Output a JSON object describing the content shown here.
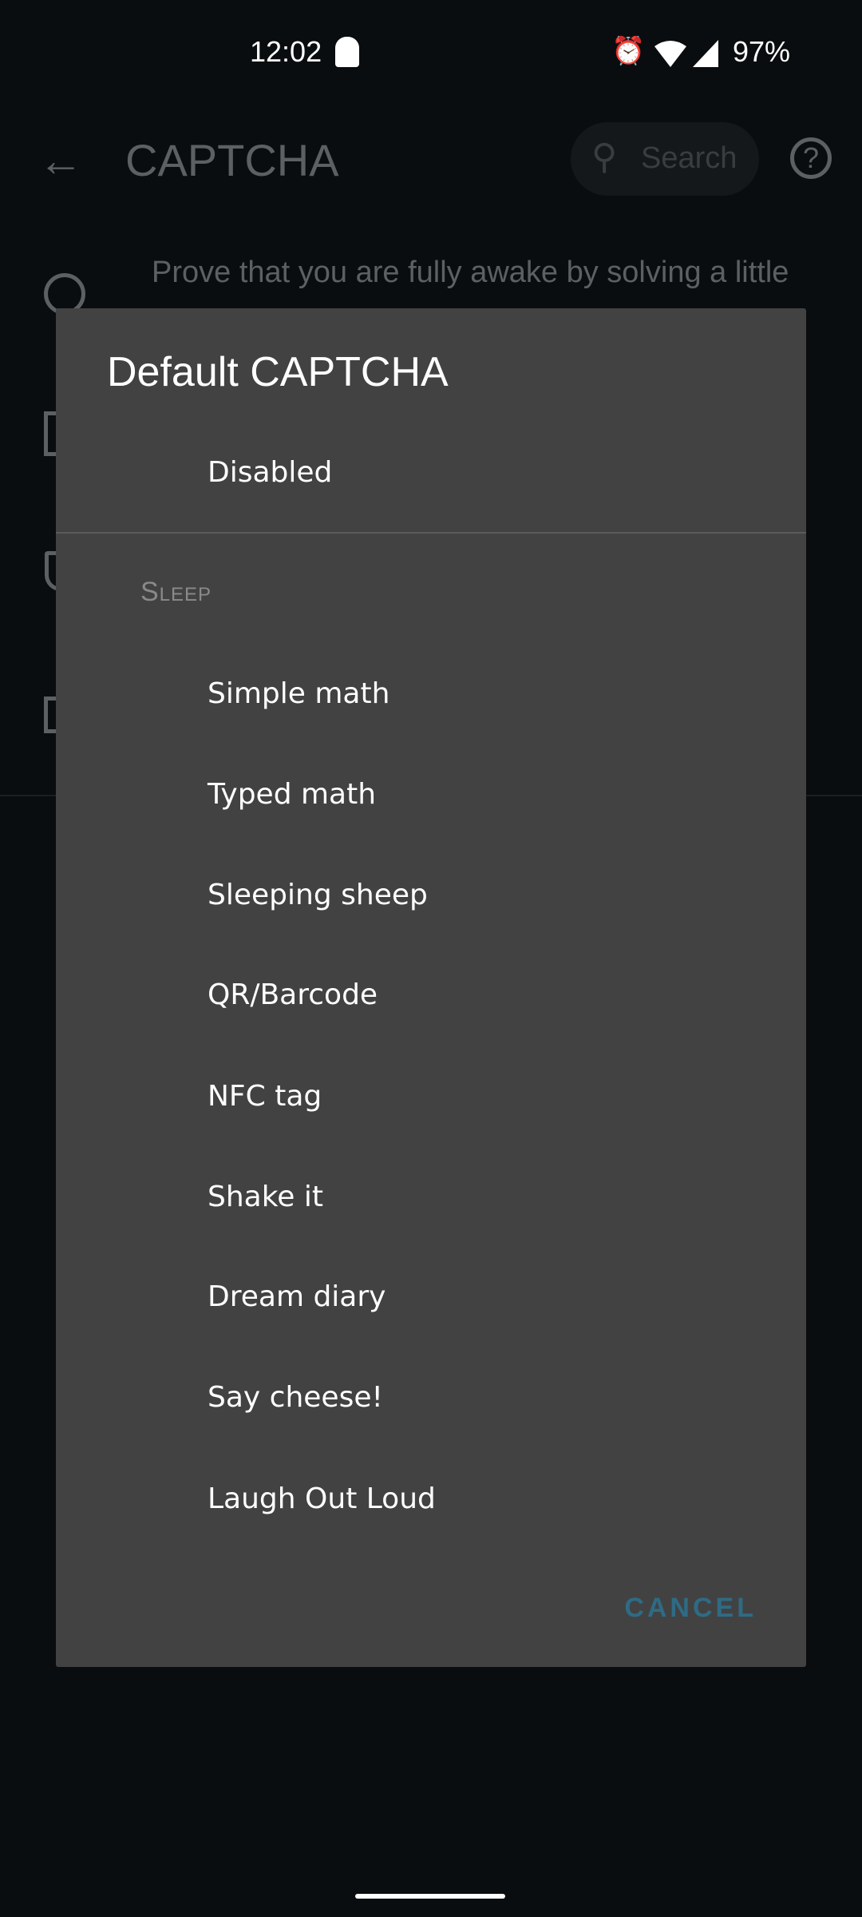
{
  "status_bar": {
    "time": "12:02",
    "battery": "97%"
  },
  "background": {
    "title": "CAPTCHA",
    "search_placeholder": "Search",
    "description": "Prove that you are fully awake by solving a little"
  },
  "dialog": {
    "title": "Default CAPTCHA",
    "disabled": "Disabled",
    "section": "Sleep",
    "items": [
      "Simple math",
      "Typed math",
      "Sleeping sheep",
      "QR/Barcode",
      "NFC tag",
      "Shake it",
      "Dream diary",
      "Say cheese!",
      "Laugh Out Loud"
    ],
    "cancel": "CANCEL"
  },
  "colors": {
    "dialog_bg": "#424242",
    "accent": "#2e6b85",
    "background": "#0a0d0f"
  }
}
